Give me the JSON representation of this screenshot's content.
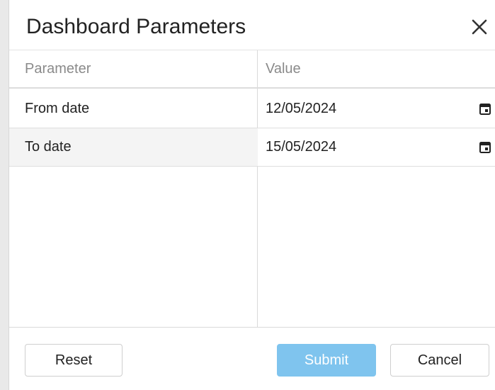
{
  "dialog": {
    "title": "Dashboard Parameters",
    "close_icon": "close-icon"
  },
  "table": {
    "headers": {
      "parameter": "Parameter",
      "value": "Value"
    },
    "rows": [
      {
        "parameter": "From date",
        "value": "12/05/2024",
        "icon": "calendar-icon"
      },
      {
        "parameter": "To date",
        "value": "15/05/2024",
        "icon": "calendar-icon"
      }
    ]
  },
  "footer": {
    "reset_label": "Reset",
    "submit_label": "Submit",
    "cancel_label": "Cancel"
  },
  "colors": {
    "submit_bg": "#7fc4ee",
    "alt_row_bg": "#f4f4f4",
    "header_text": "#8a8a8a"
  }
}
